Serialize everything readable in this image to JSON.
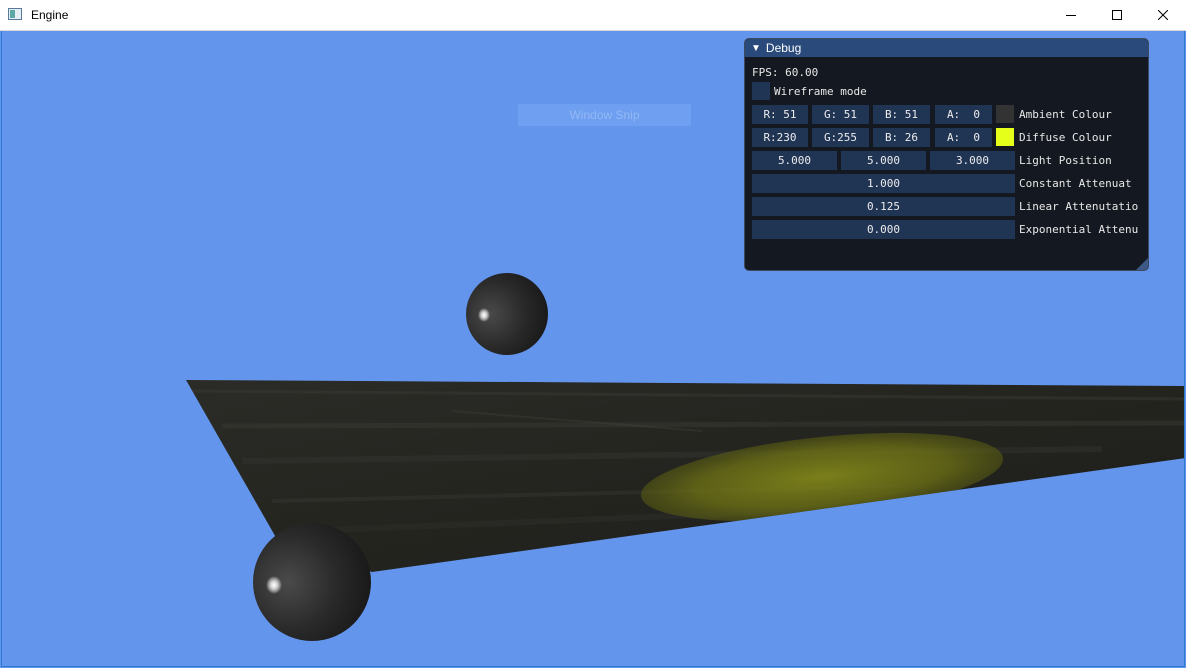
{
  "window": {
    "title": "Engine",
    "controls": {
      "minimize": "minimize-icon",
      "maximize": "maximize-icon",
      "close": "close-icon"
    }
  },
  "overlay": {
    "snip_label": "Window Snip"
  },
  "debug": {
    "title": "Debug",
    "fps_label": "FPS: 60.00",
    "wireframe": {
      "label": "Wireframe mode",
      "checked": false
    },
    "ambient": {
      "label": "Ambient Colour",
      "r": "R: 51",
      "g": "G: 51",
      "b": "B: 51",
      "a": "A:  0",
      "swatch_color": "#333333"
    },
    "diffuse": {
      "label": "Diffuse Colour",
      "r": "R:230",
      "g": "G:255",
      "b": "B: 26",
      "a": "A:  0",
      "swatch_color": "#e6ff1a"
    },
    "light_position": {
      "label": "Light Position",
      "x": "5.000",
      "y": "5.000",
      "z": "3.000"
    },
    "constant_attenuation": {
      "label": "Constant Attenuat",
      "value": "1.000"
    },
    "linear_attenuation": {
      "label": "Linear Attenutatio",
      "value": "0.125"
    },
    "exponential_attenuation": {
      "label": "Exponential Attenu",
      "value": "0.000"
    }
  },
  "colors": {
    "background": "#6495ed",
    "accent": "#294a7a",
    "field": "#203454"
  }
}
